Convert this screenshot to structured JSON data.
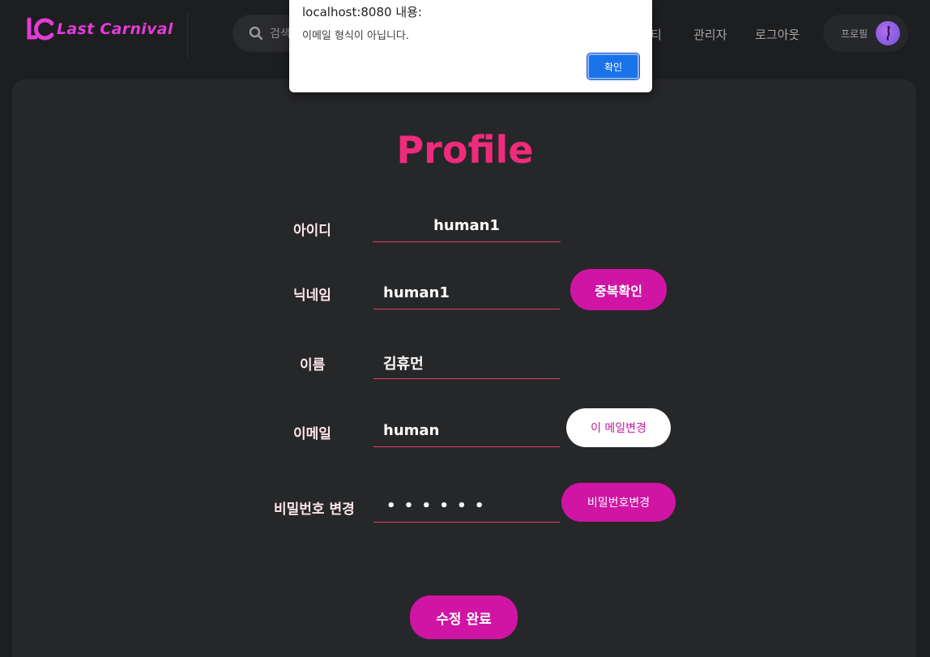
{
  "header": {
    "logo_text": "Last Carnival",
    "search_placeholder": "검색",
    "nav": [
      "티",
      "관리자",
      "로그아웃"
    ],
    "profile_label": "프로필"
  },
  "profile": {
    "title": "Profile",
    "id_label": "아이디",
    "id_value": "human1",
    "nickname_label": "닉네임",
    "nickname_value": "human1",
    "dup_check_button": "중복확인",
    "name_label": "이름",
    "name_value": "김휴먼",
    "email_label": "이메일",
    "email_value": "human",
    "email_change_button": "이 메일변경",
    "password_label": "비밀번호 변경",
    "password_value": "• • • • • •",
    "password_change_button": "비밀번호변경",
    "submit_button": "수정 완료"
  },
  "dialog": {
    "title": "localhost:8080 내용:",
    "message": "이메일 형식이 아닙니다.",
    "ok_button": "확인"
  },
  "colors": {
    "accent_pink": "#f02b7c",
    "button_magenta": "#d014a4",
    "logo_magenta": "#e23bd6",
    "dialog_blue": "#1a73e8"
  }
}
